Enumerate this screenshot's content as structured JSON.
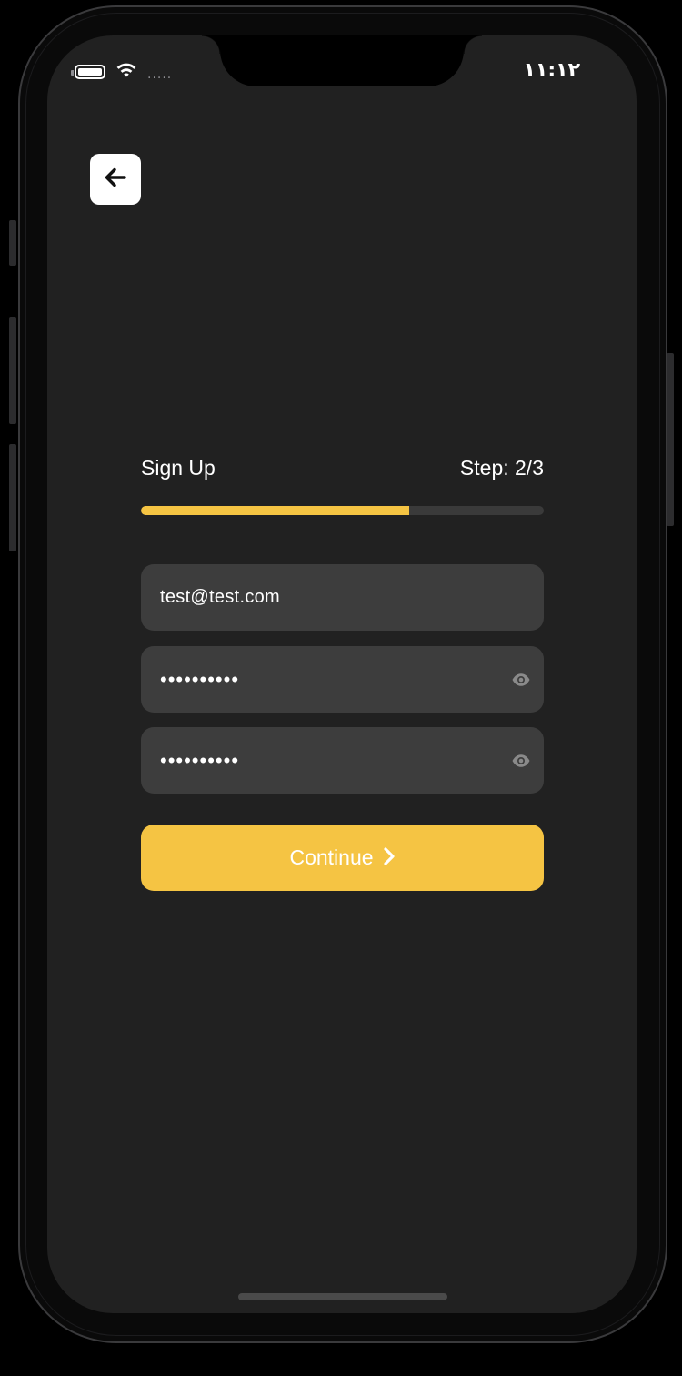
{
  "status_bar": {
    "time": "١١:١٢",
    "battery_icon": "battery-icon",
    "wifi_icon": "wifi-icon",
    "signal_dots": "....."
  },
  "nav": {
    "back_icon": "arrow-left-icon"
  },
  "signup": {
    "title": "Sign Up",
    "step_label": "Step: 2/3",
    "progress_fraction": 0.667,
    "accent_color": "#f5c443"
  },
  "form": {
    "email_value": "test@test.com",
    "password_value": "••••••••••",
    "confirm_password_value": "••••••••••",
    "password_toggle_icon": "eye-icon"
  },
  "actions": {
    "continue_label": "Continue",
    "continue_icon": "chevron-right-icon"
  }
}
